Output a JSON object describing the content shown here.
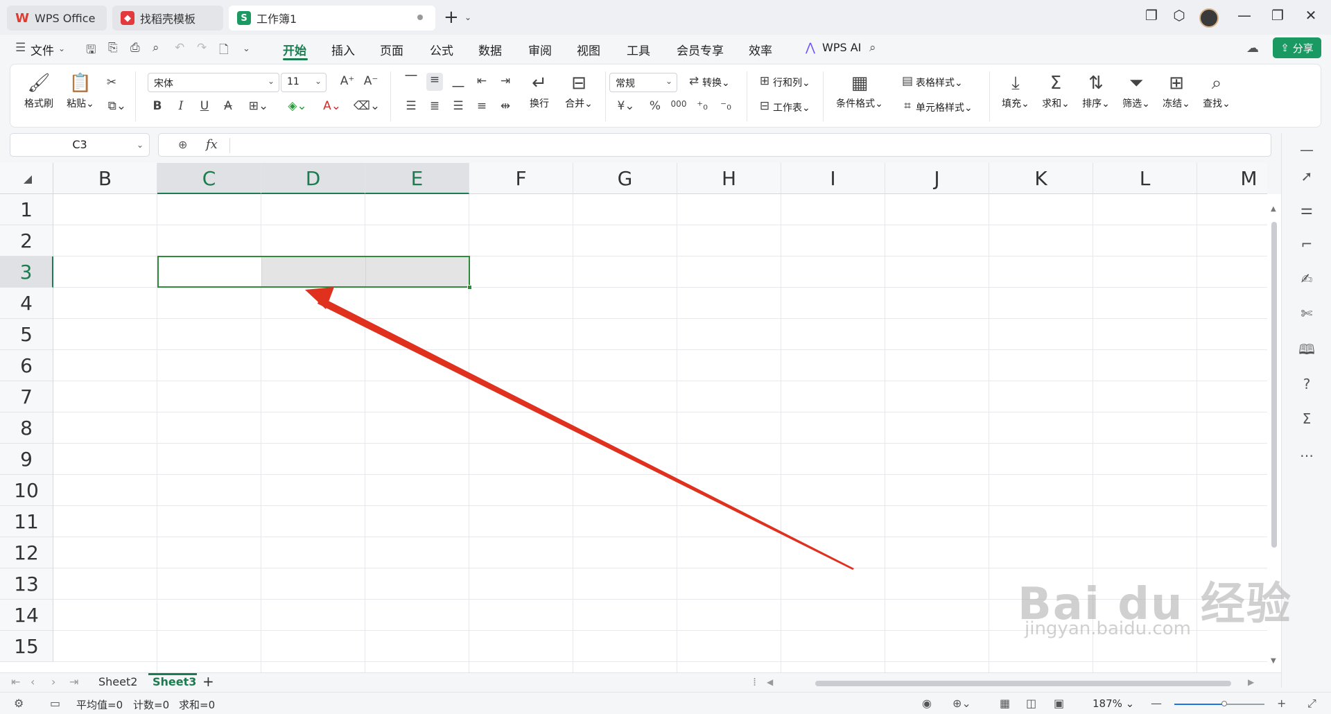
{
  "titlebar": {
    "tabs": [
      {
        "label": "WPS Office",
        "icon": "wps-logo-icon",
        "color": "#e23a2f"
      },
      {
        "label": "找稻壳模板",
        "icon": "docer-icon",
        "color": "#e4393c"
      },
      {
        "label": "工作簿1",
        "icon": "spreadsheet-s-icon",
        "color": "#1a9a62",
        "glyph": "S"
      }
    ],
    "new_tab": "+"
  },
  "menubar": {
    "file": "文件",
    "items": [
      "开始",
      "插入",
      "页面",
      "公式",
      "数据",
      "审阅",
      "视图",
      "工具",
      "会员专享",
      "效率"
    ],
    "active": "开始",
    "ai": "WPS AI",
    "share": "分享"
  },
  "ribbon": {
    "format_painter": "格式刷",
    "paste": "粘贴",
    "font_name": "宋体",
    "font_size": "11",
    "wrap": "换行",
    "merge": "合并",
    "number_format": "常规",
    "convert": "转换",
    "rows_cols": "行和列",
    "worksheet": "工作表",
    "cond_format": "条件格式",
    "table_style": "表格样式",
    "cell_style": "单元格样式",
    "fill": "填充",
    "sum": "求和",
    "sort": "排序",
    "filter": "筛选",
    "freeze": "冻结",
    "find": "查找",
    "bold": "B",
    "italic": "I",
    "underline": "U",
    "strike": "A",
    "currency": "¥",
    "percent": "%",
    "thousands": "000"
  },
  "formula": {
    "cell_ref": "C3",
    "fx": "fx",
    "value": ""
  },
  "grid": {
    "columns": [
      "B",
      "C",
      "D",
      "E",
      "F",
      "G",
      "H",
      "I",
      "J",
      "K",
      "L",
      "M"
    ],
    "rows": [
      "1",
      "2",
      "3",
      "4",
      "5",
      "6",
      "7",
      "8",
      "9",
      "10",
      "11",
      "12",
      "13",
      "14",
      "15"
    ],
    "selected_columns": [
      "C",
      "D",
      "E"
    ],
    "selected_row": "3",
    "selection": "C3:E3"
  },
  "sheets": {
    "tabs": [
      "Sheet2",
      "Sheet3"
    ],
    "active": "Sheet3",
    "add": "+"
  },
  "status": {
    "average": "平均值=0",
    "count": "计数=0",
    "sum": "求和=0",
    "zoom": "187%",
    "zoom_fraction": 0.55
  },
  "watermark": {
    "brand": "Bai du 经验",
    "url": "jingyan.baidu.com"
  },
  "colors": {
    "accent": "#1a7c4f",
    "selection_border": "#2e8b3a",
    "annotation_arrow": "#e0301e"
  }
}
